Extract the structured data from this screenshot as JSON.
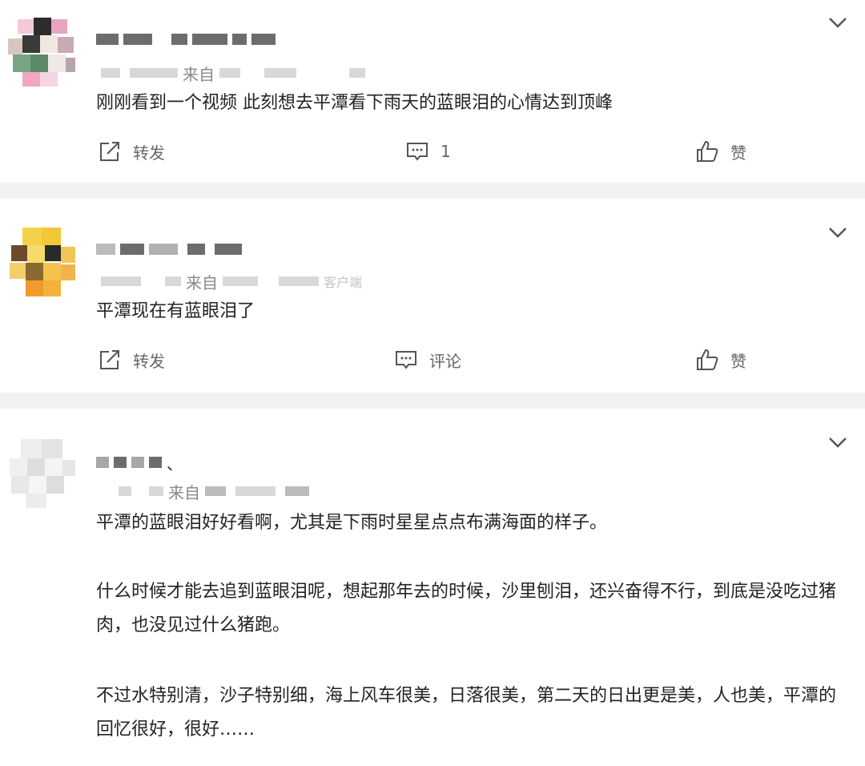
{
  "posts": [
    {
      "source_prefix": "来自",
      "text": "刚刚看到一个视频 此刻想去平潭看下雨天的蓝眼泪的心情达到顶峰",
      "actions": {
        "repost": "转发",
        "comment": "1",
        "like": "赞"
      }
    },
    {
      "source_prefix": "来自",
      "source_suffix": "客户端",
      "text": "平潭现在有蓝眼泪了",
      "actions": {
        "repost": "转发",
        "comment": "评论",
        "like": "赞"
      }
    },
    {
      "name_suffix": "、",
      "source_prefix": "来自",
      "paragraphs": [
        "平潭的蓝眼泪好好看啊，尤其是下雨时星星点点布满海面的样子。",
        "什么时候才能去追到蓝眼泪呢，想起那年去的时候，沙里刨泪，还兴奋得不行，到底是没吃过猪肉，也没见过什么猪跑。",
        "不过水特别清，沙子特别细，海上风车很美，日落很美，第二天的日出更是美，人也美，平潭的回忆很好，很好……"
      ]
    }
  ],
  "colors": {
    "background": "#ffffff",
    "separator": "#f2f2f2",
    "text": "#222222",
    "meta": "#888888",
    "action": "#666666"
  },
  "icons": [
    "chevron-down-icon",
    "share-icon",
    "comment-icon",
    "like-icon"
  ]
}
